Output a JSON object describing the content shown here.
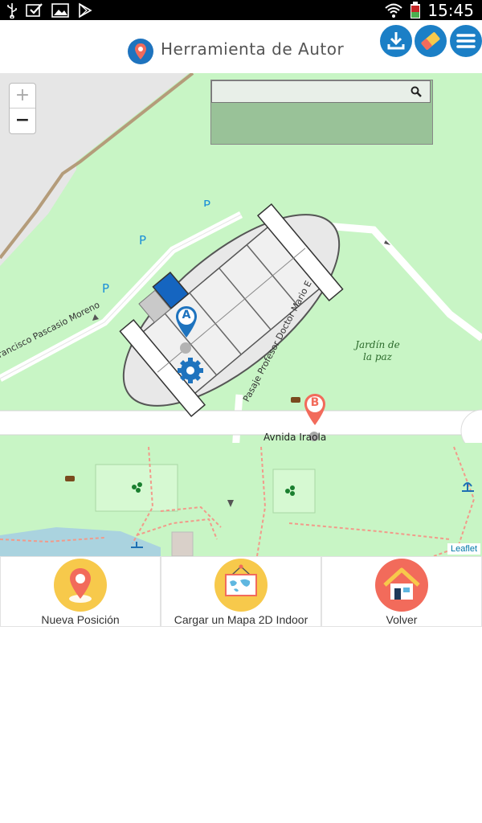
{
  "status_bar": {
    "time": "15:45",
    "left_icons": [
      "usb-icon",
      "check-icon",
      "image-icon",
      "play-store-icon"
    ],
    "right_icons": [
      "wifi-icon",
      "battery-icon"
    ]
  },
  "header": {
    "title": "Herramienta de Autor",
    "logo_icon": "map-pin-icon",
    "buttons": [
      {
        "name": "download-button",
        "icon": "download-icon"
      },
      {
        "name": "eraser-button",
        "icon": "eraser-icon"
      },
      {
        "name": "menu-button",
        "icon": "hamburger-menu-icon"
      }
    ]
  },
  "map": {
    "zoom_in": "+",
    "zoom_out": "−",
    "attribution": "Leaflet",
    "labels": {
      "street_pascasio": "Francisco Pascasio Moreno",
      "street_pasaje": "Pasaje Profesor Doctor Mario E",
      "street_iraola": "Avnida Iraola",
      "garden_line1": "Jardín de",
      "garden_line2": "la paz",
      "parking_1": "P",
      "parking_2": "P",
      "parking_3": "P"
    },
    "markers": {
      "a": "A",
      "b": "B"
    },
    "colors": {
      "park": "#c8f5c5",
      "marker_a": "#1e73be",
      "marker_b": "#f26b5b",
      "room_blue": "#1565c0"
    }
  },
  "bottom_nav": {
    "items": [
      {
        "label": "Nueva Posición",
        "icon": "location-pin-icon",
        "color": "#f7c94b"
      },
      {
        "label": "Cargar un Mapa 2D Indoor",
        "icon": "world-map-icon",
        "color": "#f7c94b"
      },
      {
        "label": "Volver",
        "icon": "home-icon",
        "color": "#f26b5b"
      }
    ]
  }
}
